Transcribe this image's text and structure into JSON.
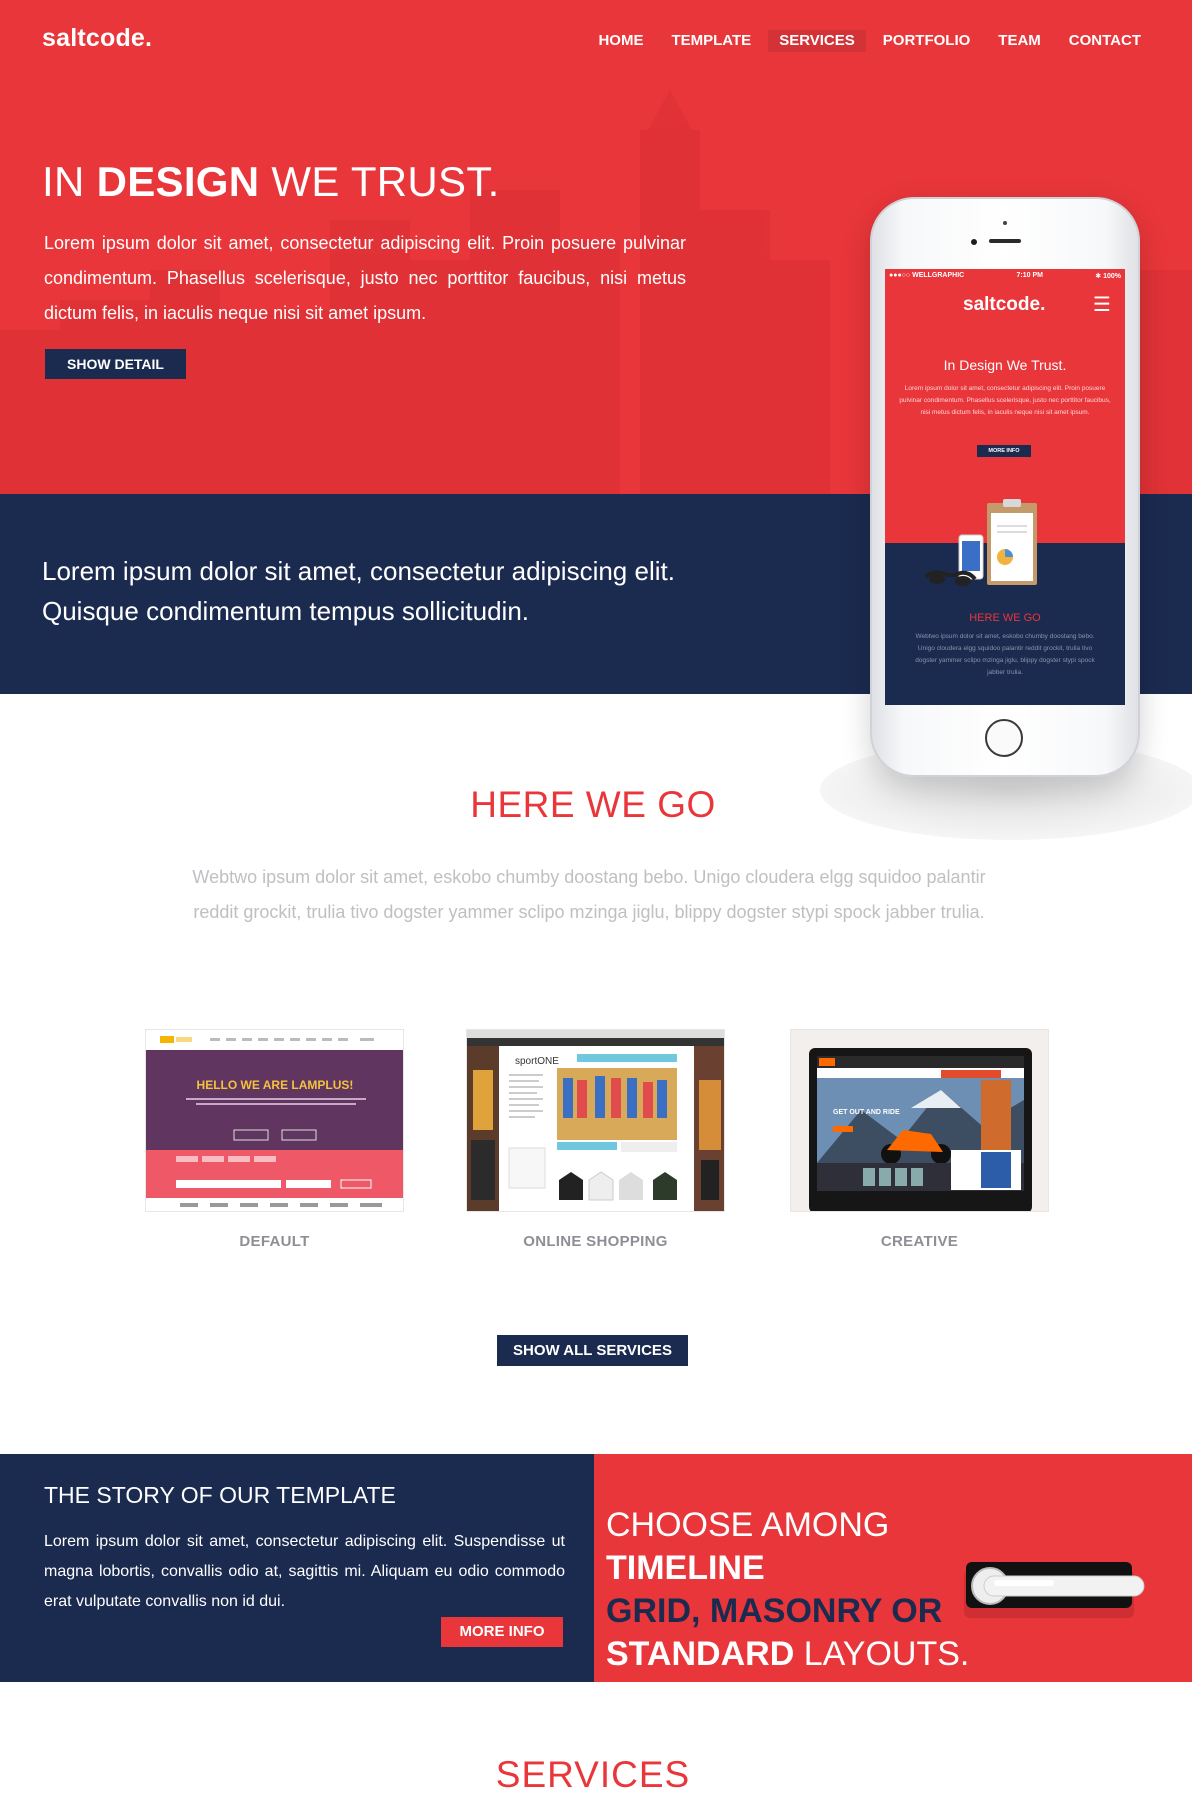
{
  "brand": {
    "logo": "saltcode."
  },
  "nav": {
    "items": [
      {
        "label": "HOME"
      },
      {
        "label": "TEMPLATE"
      },
      {
        "label": "SERVICES"
      },
      {
        "label": "PORTFOLIO"
      },
      {
        "label": "TEAM"
      },
      {
        "label": "CONTACT"
      }
    ],
    "active": "SERVICES"
  },
  "hero": {
    "title_pre": "IN ",
    "title_bold": "DESIGN",
    "title_post": " WE TRUST.",
    "text": "Lorem ipsum dolor sit amet, consectetur adipiscing elit. Proin posuere pulvinar condimentum. Phasellus scelerisque, justo nec porttitor faucibus, nisi metus dictum felis, in iaculis neque nisi sit amet ipsum.",
    "button": "SHOW DETAIL"
  },
  "band": {
    "text": "Lorem ipsum dolor sit amet, consectetur adipiscing elit. Quisque condimentum tempus sollicitudin."
  },
  "phone": {
    "carrier": "●●●○○ WELLGRAPHIC",
    "time": "7:10 PM",
    "battery": "✱ 100%",
    "logo": "saltcode.",
    "menu_icon": "☰",
    "title": "In Design We Trust.",
    "text": "Lorem ipsum dolor sit amet, consectetur adipiscing elit. Proin posuere pulvinar condimentum. Phasellus scelerisque, justo nec porttitor faucibus, nisi metus dictum felis, in iaculis neque nisi sit amet ipsum.",
    "button": "MORE INFO",
    "heading": "HERE WE GO",
    "text2": "Webtwo ipsum dolor sit amet, eskobo chumby doostang bebo. Unigo cloudera elgg squidoo palantir reddit grockit, trulia tivo dogster yammer sclipo mzinga jiglu, blippy dogster stypi spock jabber trulia."
  },
  "here_we_go": {
    "title": "HERE WE GO",
    "text": "Webtwo ipsum dolor sit amet, eskobo chumby doostang bebo. Unigo cloudera elgg squidoo palantir reddit grockit, trulia tivo dogster yammer sclipo mzinga jiglu, blippy dogster stypi spock jabber trulia.",
    "cards": [
      {
        "label": "DEFAULT",
        "headline": "HELLO WE ARE LAMPLUS!"
      },
      {
        "label": "ONLINE SHOPPING",
        "headline": "sportONE"
      },
      {
        "label": "CREATIVE",
        "headline": "GET OUT AND RIDE"
      }
    ],
    "button": "SHOW ALL SERVICES"
  },
  "story": {
    "title": "THE STORY OF OUR TEMPLATE",
    "text": "Lorem ipsum dolor sit amet, consectetur adipiscing elit. Suspendisse ut magna lobortis, convallis odio at, sagittis mi. Aliquam eu odio commodo erat vulputate convallis non id dui.",
    "button": "MORE INFO"
  },
  "choose": {
    "p1": "CHOOSE AMONG ",
    "b1": "TIMELINE",
    "n1": "GRID, MASONRY OR",
    "b2": "STANDARD",
    "p2": " LAYOUTS."
  },
  "services": {
    "title": "SERVICES"
  },
  "colors": {
    "red": "#e9363a",
    "navy": "#1b2a4f",
    "muted": "#bfbfc4"
  }
}
